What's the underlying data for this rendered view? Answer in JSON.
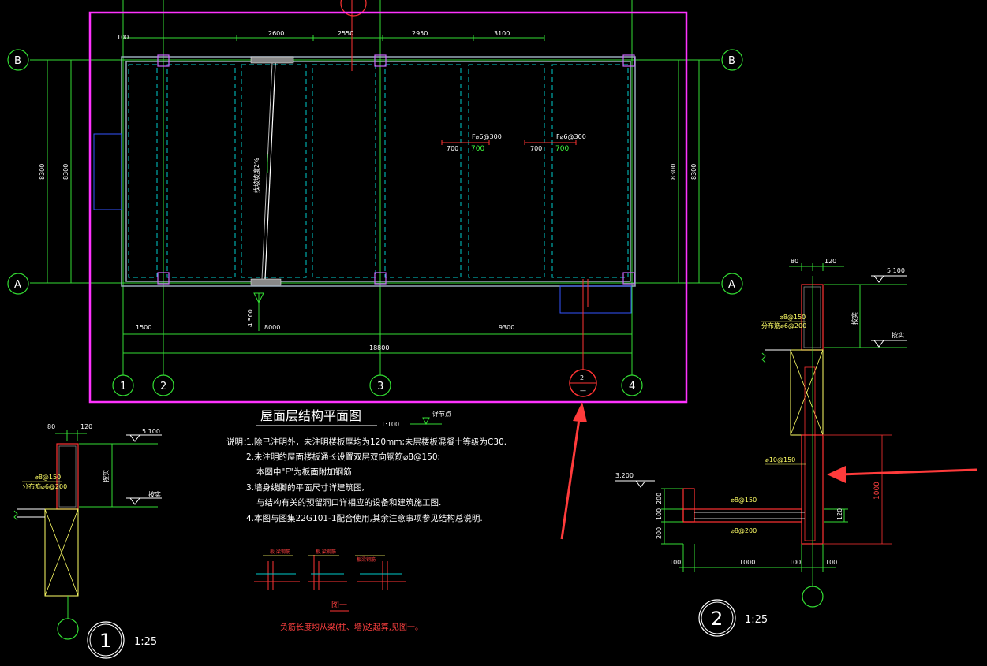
{
  "colors": {
    "background": "#000000",
    "viewport_frame": "#ff33ff",
    "axis": "#33ff33",
    "wall": "#00cccc",
    "rebar": "#ff3333",
    "dimension": "#33ff33",
    "annotation_arrow": "#ff3b3b"
  },
  "plan": {
    "axis_rows": [
      "B",
      "A"
    ],
    "axis_cols": [
      "1",
      "2",
      "3",
      "4"
    ],
    "dims_top": [
      "100",
      "2600",
      "2550",
      "2950",
      "3100"
    ],
    "dims_side": [
      "8300",
      "8300"
    ],
    "dims_right": [
      "8300",
      "8300"
    ],
    "dims_bottom": [
      "1500",
      "8000",
      "9300"
    ],
    "dims_total": "18800",
    "elev_label": "4.500",
    "slope_text": "找坡坡度2%",
    "rebar_notes": [
      {
        "label": "F⌀6@300",
        "left": "700",
        "right": "700"
      },
      {
        "label": "F⌀6@300",
        "left": "700",
        "right": "700"
      }
    ],
    "section_marker": {
      "number": "2",
      "sheet": "—"
    },
    "title": "屋面层结构平面图",
    "scale": "1:100",
    "small_label": "详节点"
  },
  "notes": {
    "heading": "说明：",
    "lines": [
      "1.除已注明外，未注明楼板厚均为120mm;未层楼板混凝土等级为C30.",
      "2.未注明的屋面楼板通长设置双层双向钢筋⌀8@150;",
      "本图中\"F\"为板面附加钢筋",
      "3.墙身线脚的平面尺寸详建筑图,",
      "与结构有关的预留洞口详相应的设备和建筑施工图.",
      "4.本图与图集22G101-1配合使用,其余注意事项参见结构总说明."
    ]
  },
  "figure": {
    "caption": "图一",
    "note": "负筋长度均从梁(柱、墙)边起算,见图一。",
    "labels": [
      "板,梁钢筋",
      "板,梁钢筋",
      "板梁钢筋"
    ]
  },
  "detail1": {
    "dims": [
      "80",
      "120"
    ],
    "elev": "5.100",
    "rebar1": "⌀8@150",
    "rebar2": "分布筋⌀6@200",
    "side_label": "按实",
    "mark": "按实",
    "number": "1",
    "scale": "1:25"
  },
  "detail2": {
    "dims": [
      "80",
      "120"
    ],
    "elev_top": "5.100",
    "elev_left": "3.200",
    "rebar1": "⌀8@150",
    "rebar2": "分布筋⌀6@200",
    "rebar3": "⌀10@150",
    "rebar4": "⌀8@150",
    "rebar5": "⌀8@200",
    "side_label": "按实",
    "mark": "按实",
    "v_dims": [
      "200",
      "100",
      "200"
    ],
    "dim_right": "1000",
    "dim_120": "120",
    "bottom_dims": [
      "100",
      "1000",
      "100",
      "100"
    ],
    "number": "2",
    "scale": "1:25"
  }
}
